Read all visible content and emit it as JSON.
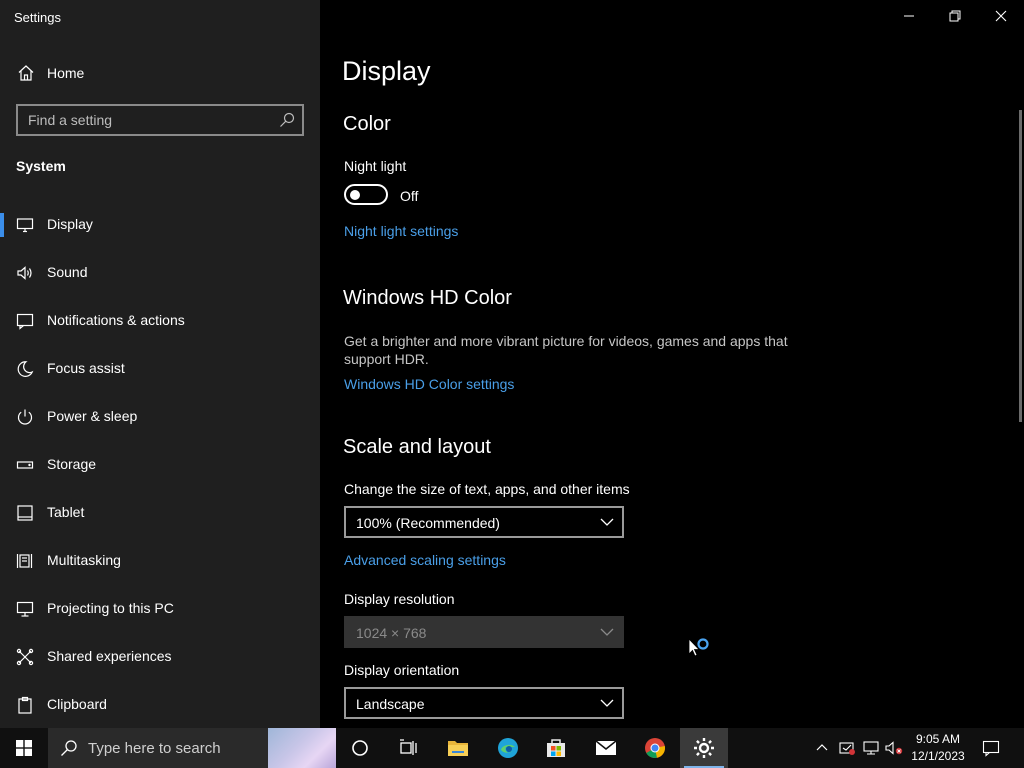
{
  "window": {
    "title": "Settings"
  },
  "sidebar": {
    "home_label": "Home",
    "search_placeholder": "Find a setting",
    "section_label": "System",
    "items": [
      {
        "label": "Display",
        "icon": "monitor-icon",
        "active": true
      },
      {
        "label": "Sound",
        "icon": "speaker-icon"
      },
      {
        "label": "Notifications & actions",
        "icon": "notification-icon"
      },
      {
        "label": "Focus assist",
        "icon": "moon-icon"
      },
      {
        "label": "Power & sleep",
        "icon": "power-icon"
      },
      {
        "label": "Storage",
        "icon": "storage-icon"
      },
      {
        "label": "Tablet",
        "icon": "tablet-icon"
      },
      {
        "label": "Multitasking",
        "icon": "multitasking-icon"
      },
      {
        "label": "Projecting to this PC",
        "icon": "projector-icon"
      },
      {
        "label": "Shared experiences",
        "icon": "share-icon"
      },
      {
        "label": "Clipboard",
        "icon": "clipboard-icon"
      }
    ]
  },
  "main": {
    "page_title": "Display",
    "color": {
      "heading": "Color",
      "night_light_label": "Night light",
      "night_light_state": "Off",
      "night_light_settings_link": "Night light settings"
    },
    "hd_color": {
      "heading": "Windows HD Color",
      "description": "Get a brighter and more vibrant picture for videos, games and apps that support HDR.",
      "settings_link": "Windows HD Color settings"
    },
    "scale_layout": {
      "heading": "Scale and layout",
      "scale_label": "Change the size of text, apps, and other items",
      "scale_value": "100% (Recommended)",
      "advanced_link": "Advanced scaling settings",
      "resolution_label": "Display resolution",
      "resolution_value": "1024 × 768",
      "orientation_label": "Display orientation",
      "orientation_value": "Landscape"
    }
  },
  "taskbar": {
    "search_text": "Type here to search",
    "time": "9:05 AM",
    "date": "12/1/2023"
  },
  "colors": {
    "accent_link": "#4a9fe8",
    "sidebar_bg": "#1f1f1f",
    "main_bg": "#000000",
    "active_indicator": "#3b8eea"
  }
}
